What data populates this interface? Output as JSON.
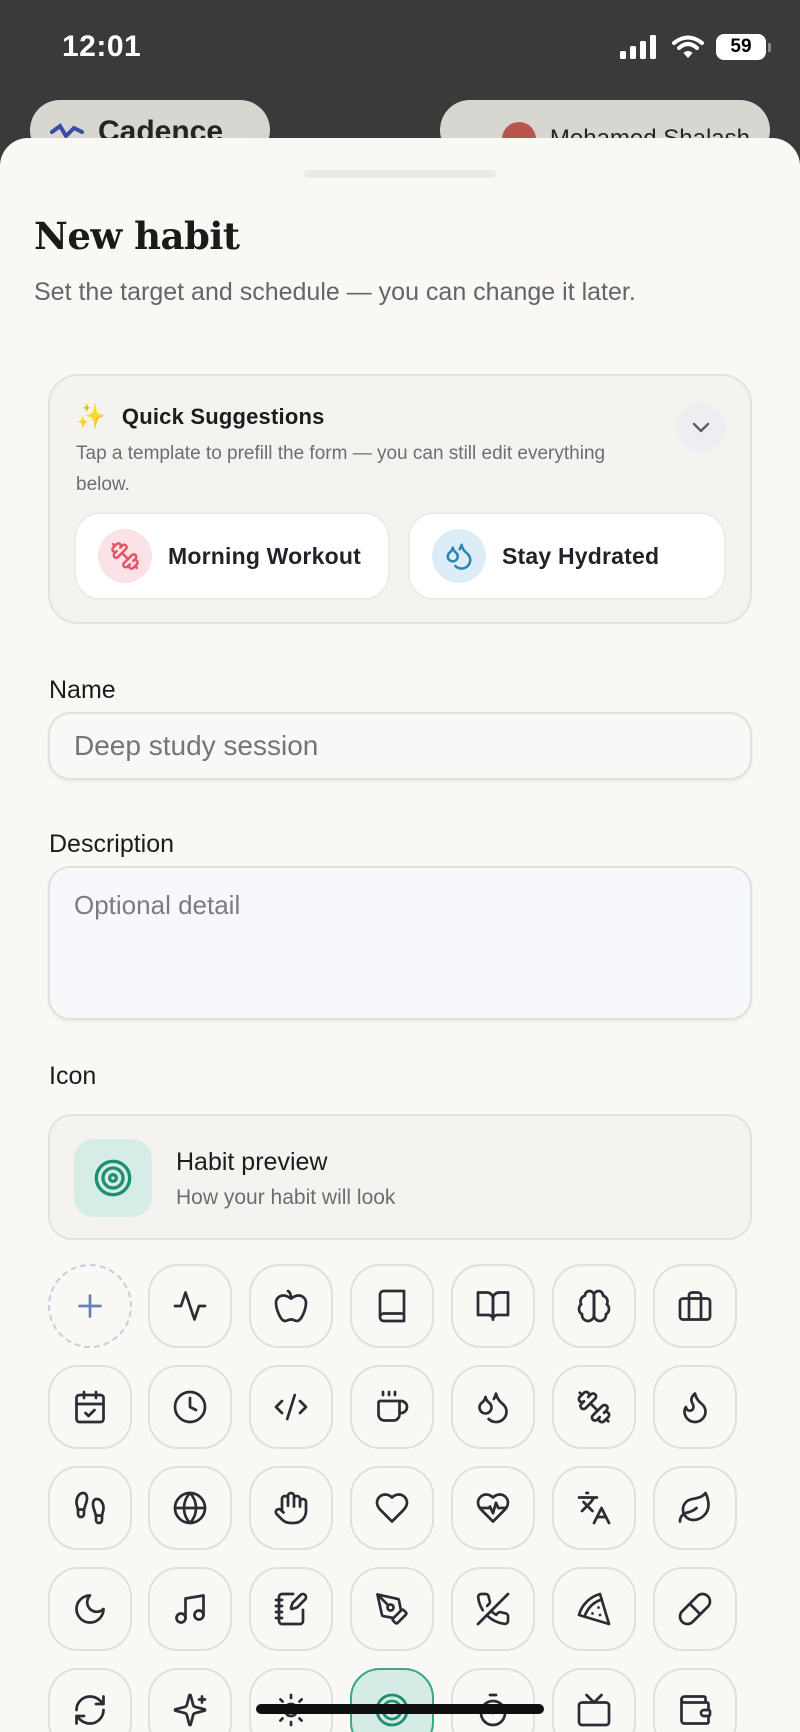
{
  "status_bar": {
    "time": "12:01",
    "battery": "59"
  },
  "background_app": {
    "brand": "Cadence",
    "user": "Mohamed Shalash"
  },
  "sheet": {
    "title": "New habit",
    "subtitle": "Set the target and schedule — you can change it later."
  },
  "suggestions": {
    "title": "Quick Suggestions",
    "description": "Tap a template to prefill the form — you can still edit everything below.",
    "items": [
      {
        "label": "Morning Workout",
        "icon": "dumbbell-icon",
        "color": "#e5536b",
        "bg": "#fbe2e6"
      },
      {
        "label": "Stay Hydrated",
        "icon": "droplets-icon",
        "color": "#2d84b5",
        "bg": "#dcedf7"
      }
    ]
  },
  "form": {
    "name_label": "Name",
    "name_placeholder": "Deep study session",
    "description_label": "Description",
    "description_placeholder": "Optional detail",
    "icon_label": "Icon"
  },
  "preview": {
    "title": "Habit preview",
    "subtitle": "How your habit will look",
    "icon": "target-icon",
    "accent": "#1f8f72"
  },
  "icon_grid": [
    [
      "plus-icon",
      "activity-icon",
      "apple-icon",
      "book-icon",
      "book-open-icon",
      "brain-icon",
      "briefcase-icon"
    ],
    [
      "calendar-check-icon",
      "clock-icon",
      "code-icon",
      "coffee-icon",
      "droplets-icon",
      "dumbbell-icon",
      "flame-icon"
    ],
    [
      "footprints-icon",
      "globe-icon",
      "hand-icon",
      "heart-icon",
      "heart-pulse-icon",
      "languages-icon",
      "leaf-icon"
    ],
    [
      "moon-icon",
      "music-icon",
      "notebook-pen-icon",
      "pen-tool-icon",
      "phone-off-icon",
      "pizza-icon",
      "pill-icon"
    ],
    [
      "refresh-icon",
      "sparkles-icon",
      "sun-icon",
      "target-icon",
      "timer-icon",
      "tv-icon",
      "wallet-icon"
    ]
  ],
  "selected_icon": "target-icon"
}
